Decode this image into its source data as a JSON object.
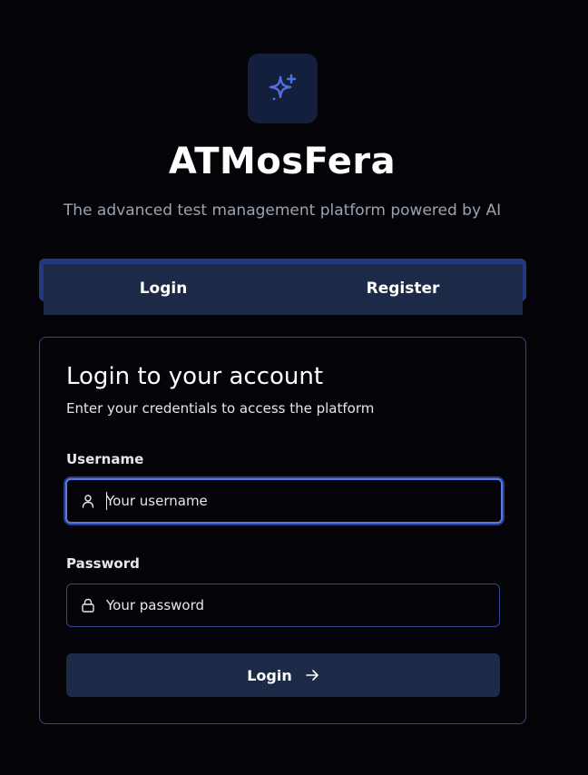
{
  "app": {
    "title": "ATMosFera",
    "subtitle": "The advanced test management platform powered by AI",
    "logo_icon": "sparkles-icon",
    "accent_color": "#4f6fe0"
  },
  "tabs": [
    {
      "label": "Login",
      "active": true
    },
    {
      "label": "Register",
      "active": false
    }
  ],
  "login_card": {
    "title": "Login to your account",
    "description": "Enter your credentials to access the platform",
    "username": {
      "label": "Username",
      "value": "",
      "placeholder": "Your username",
      "icon": "user-icon",
      "focused": true
    },
    "password": {
      "label": "Password",
      "value": "",
      "placeholder": "Your password",
      "icon": "lock-icon"
    },
    "submit": {
      "label": "Login",
      "icon": "arrow-right-icon"
    }
  }
}
